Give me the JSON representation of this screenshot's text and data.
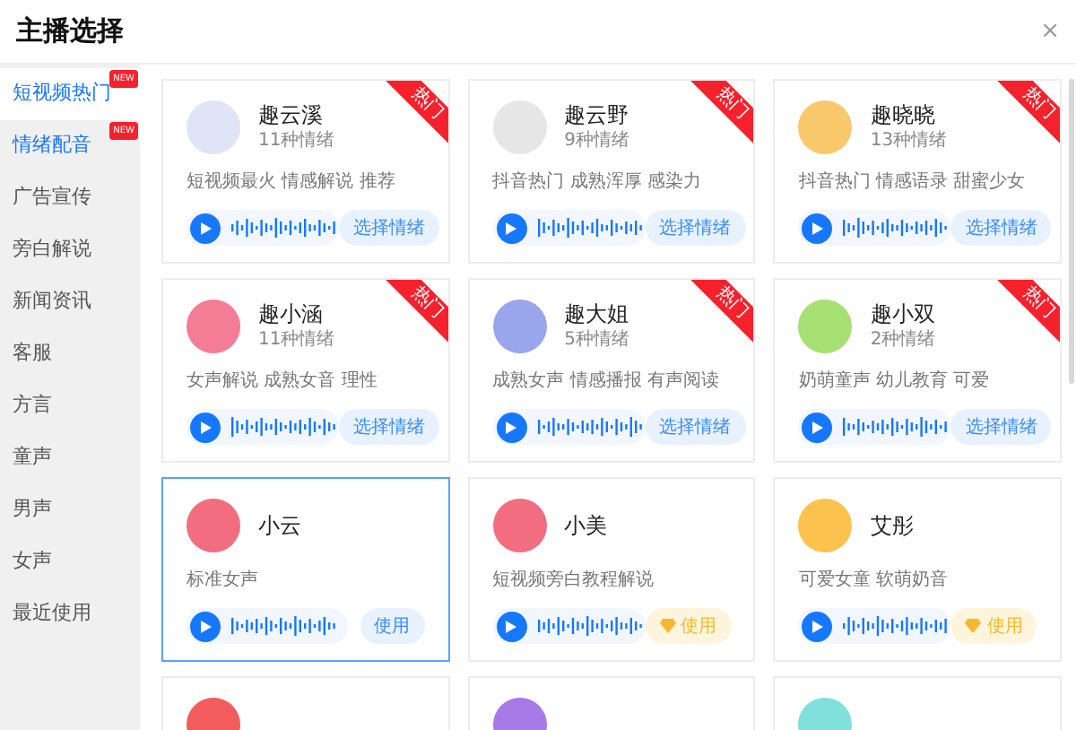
{
  "title": "主播选择",
  "close": "×",
  "sidebar": [
    {
      "label": "短视频热门",
      "selected": true,
      "highlighted": true,
      "new_badge": "NEW"
    },
    {
      "label": "情绪配音",
      "selected": false,
      "highlighted": true,
      "new_badge": "NEW"
    },
    {
      "label": "广告宣传",
      "selected": false,
      "highlighted": false
    },
    {
      "label": "旁白解说",
      "selected": false,
      "highlighted": false
    },
    {
      "label": "新闻资讯",
      "selected": false,
      "highlighted": false
    },
    {
      "label": "客服",
      "selected": false,
      "highlighted": false
    },
    {
      "label": "方言",
      "selected": false,
      "highlighted": false
    },
    {
      "label": "童声",
      "selected": false,
      "highlighted": false
    },
    {
      "label": "男声",
      "selected": false,
      "highlighted": false
    },
    {
      "label": "女声",
      "selected": false,
      "highlighted": false
    },
    {
      "label": "最近使用",
      "selected": false,
      "highlighted": false
    }
  ],
  "cards": [
    {
      "name": "趣云溪",
      "emotions": "11种情绪",
      "tags": "短视频最火 情感解说 推荐",
      "hot": "热门",
      "action": {
        "kind": "choose",
        "label": "选择情绪"
      },
      "selected": false,
      "color": "#dfe4f7"
    },
    {
      "name": "趣云野",
      "emotions": "9种情绪",
      "tags": "抖音热门 成熟浑厚 感染力",
      "hot": "热门",
      "action": {
        "kind": "choose",
        "label": "选择情绪"
      },
      "selected": false,
      "color": "#e6e6e6"
    },
    {
      "name": "趣晓晓",
      "emotions": "13种情绪",
      "tags": "抖音热门 情感语录 甜蜜少女",
      "hot": "热门",
      "action": {
        "kind": "choose",
        "label": "选择情绪"
      },
      "selected": false,
      "color": "#f9c86a"
    },
    {
      "name": "趣小涵",
      "emotions": "11种情绪",
      "tags": "女声解说 成熟女音 理性",
      "hot": "热门",
      "action": {
        "kind": "choose",
        "label": "选择情绪"
      },
      "selected": false,
      "color": "#f47c94"
    },
    {
      "name": "趣大姐",
      "emotions": "5种情绪",
      "tags": "成熟女声 情感播报 有声阅读",
      "hot": "热门",
      "action": {
        "kind": "choose",
        "label": "选择情绪"
      },
      "selected": false,
      "color": "#9aa6ec"
    },
    {
      "name": "趣小双",
      "emotions": "2种情绪",
      "tags": "奶萌童声 幼儿教育 可爱",
      "hot": "热门",
      "action": {
        "kind": "choose",
        "label": "选择情绪"
      },
      "selected": false,
      "color": "#a6df72"
    },
    {
      "name": "小云",
      "tags": "标准女声",
      "action": {
        "kind": "use",
        "label": "使用"
      },
      "selected": true,
      "color": "#f26d80"
    },
    {
      "name": "小美",
      "tags": "短视频旁白教程解说",
      "action": {
        "kind": "vip",
        "label": "使用"
      },
      "selected": false,
      "color": "#f26d80"
    },
    {
      "name": "艾彤",
      "tags": "可爱女童 软萌奶音",
      "action": {
        "kind": "vip",
        "label": "使用"
      },
      "selected": false,
      "color": "#fbc34e"
    },
    {
      "selected": false,
      "color": "#f25c5c"
    },
    {
      "selected": false,
      "color": "#a77ae8"
    },
    {
      "selected": false,
      "color": "#7fe0dc"
    }
  ]
}
